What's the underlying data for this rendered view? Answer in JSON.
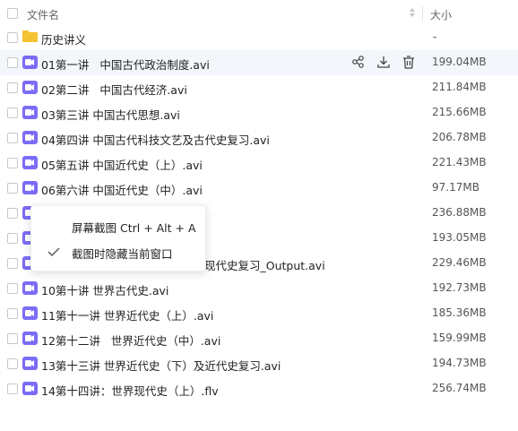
{
  "header": {
    "name_label": "文件名",
    "size_label": "大小"
  },
  "files": [
    {
      "name": "历史讲义",
      "size": "-",
      "type": "folder"
    },
    {
      "name": "01第一讲   中国古代政治制度.avi",
      "size": "199.04MB",
      "type": "video"
    },
    {
      "name": "02第二讲   中国古代经济.avi",
      "size": "211.84MB",
      "type": "video"
    },
    {
      "name": "03第三讲 中国古代思想.avi",
      "size": "215.66MB",
      "type": "video"
    },
    {
      "name": "04第四讲 中国古代科技文艺及古代史复习.avi",
      "size": "206.78MB",
      "type": "video"
    },
    {
      "name": "05第五讲 中国近代史（上）.avi",
      "size": "221.43MB",
      "type": "video"
    },
    {
      "name": "06第六讲 中国近代史（中）.avi",
      "size": "97.17MB",
      "type": "video"
    },
    {
      "name": "",
      "size": "236.88MB",
      "type": "video"
    },
    {
      "name": "",
      "size": "193.05MB",
      "type": "video"
    },
    {
      "name": "现代史复习_Output.avi",
      "size": "229.46MB",
      "type": "video"
    },
    {
      "name": "10第十讲 世界古代史.avi",
      "size": "192.73MB",
      "type": "video"
    },
    {
      "name": "11第十一讲 世界近代史（上）.avi",
      "size": "185.36MB",
      "type": "video"
    },
    {
      "name": "12第十二讲   世界近代史（中）.avi",
      "size": "159.99MB",
      "type": "video"
    },
    {
      "name": "13第十三讲 世界近代史（下）及近代史复习.avi",
      "size": "194.73MB",
      "type": "video"
    },
    {
      "name": "14第十四讲：世界现代史（上）.flv",
      "size": "256.74MB",
      "type": "video"
    }
  ],
  "hover_row_index": 1,
  "context_menu": {
    "items": [
      {
        "label": "屏幕截图 Ctrl + Alt + A",
        "checked": false
      },
      {
        "label": "截图时隐藏当前窗口",
        "checked": true
      }
    ]
  },
  "colors": {
    "video_icon": "#7b6cf6",
    "folder_icon": "#f5c231",
    "hover_row": "#f3f6fb"
  },
  "icons": {
    "share": "share-icon",
    "download": "download-icon",
    "delete": "trash-icon",
    "sort": "sort-icon",
    "check": "check-icon"
  }
}
